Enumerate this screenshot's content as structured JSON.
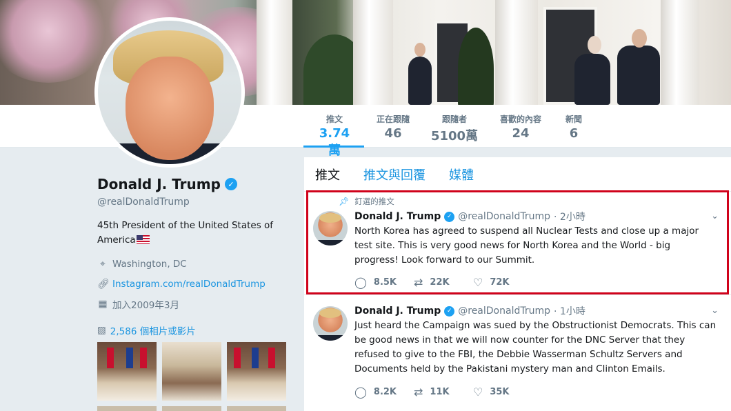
{
  "profile": {
    "name": "Donald J. Trump",
    "handle": "@realDonaldTrump",
    "bio": "45th President of the United States of America",
    "location": "Washington, DC",
    "website": "Instagram.com/realDonaldTrump",
    "joined": "加入2009年3月",
    "photos_label": "2,586 個相片或影片"
  },
  "nav": {
    "items": [
      {
        "label": "推文",
        "value": "3.74萬"
      },
      {
        "label": "正在跟隨",
        "value": "46"
      },
      {
        "label": "跟隨者",
        "value": "5100萬"
      },
      {
        "label": "喜歡的內容",
        "value": "24"
      },
      {
        "label": "新聞",
        "value": "6"
      }
    ]
  },
  "tabs": [
    "推文",
    "推文與回覆",
    "媒體"
  ],
  "tweets": [
    {
      "pinned_label": "釘選的推文",
      "name": "Donald J. Trump",
      "handle": "@realDonaldTrump",
      "time": "· 2小時",
      "text": "North Korea has agreed to suspend all Nuclear Tests and close up a major test site. This is very good news for North Korea and the World - big progress! Look forward to our Summit.",
      "replies": "8.5K",
      "retweets": "22K",
      "likes": "72K"
    },
    {
      "name": "Donald J. Trump",
      "handle": "@realDonaldTrump",
      "time": "· 1小時",
      "text": "Just heard the Campaign was sued by the Obstructionist Democrats. This can be good news in that we will now counter for the DNC Server that they refused to give to the FBI, the Debbie Wasserman Schultz Servers and Documents held by the Pakistani mystery man and Clinton Emails.",
      "replies": "8.2K",
      "retweets": "11K",
      "likes": "35K"
    }
  ],
  "icons": {
    "verified": "verified-badge-icon",
    "location": "location-pin-icon",
    "link": "link-icon",
    "calendar": "calendar-icon",
    "photo": "photo-icon",
    "pin": "pin-icon",
    "reply": "reply-icon",
    "retweet": "retweet-icon",
    "like": "heart-icon",
    "caret": "chevron-down-icon"
  },
  "colors": {
    "accent": "#1da1f2",
    "link": "#1b95e0",
    "highlight": "#d0021b"
  }
}
